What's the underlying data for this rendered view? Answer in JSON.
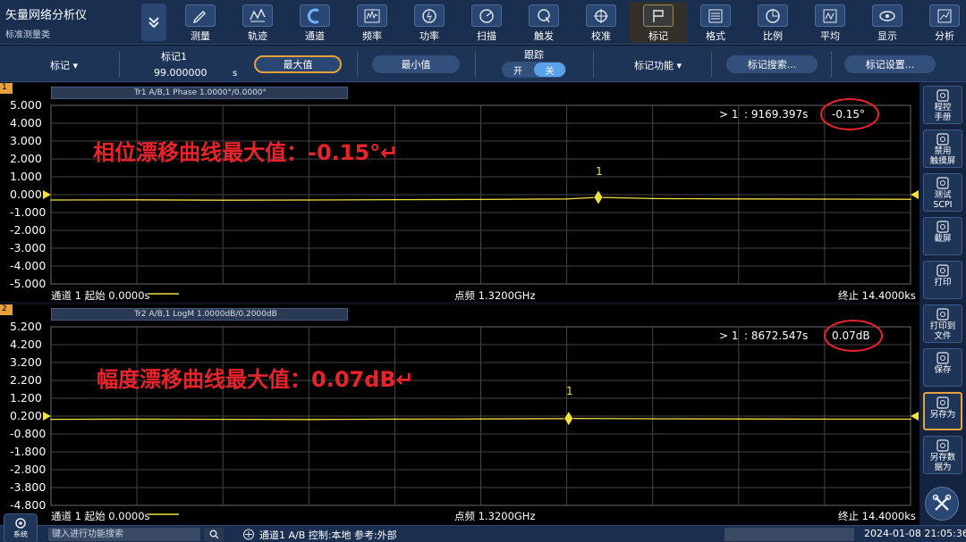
{
  "app": {
    "title": "矢量网络分析仪",
    "subtitle": "标准测量类"
  },
  "tabs": [
    {
      "label": "测量",
      "icon": "pencil-icon"
    },
    {
      "label": "轨迹",
      "icon": "trace-icon"
    },
    {
      "label": "通道",
      "icon": "channel-icon"
    },
    {
      "label": "频率",
      "icon": "frequency-icon"
    },
    {
      "label": "功率",
      "icon": "power-icon"
    },
    {
      "label": "扫描",
      "icon": "sweep-icon"
    },
    {
      "label": "触发",
      "icon": "trigger-icon"
    },
    {
      "label": "校准",
      "icon": "calibration-icon"
    },
    {
      "label": "标记",
      "icon": "marker-flag-icon",
      "active": true
    },
    {
      "label": "格式",
      "icon": "format-icon"
    },
    {
      "label": "比例",
      "icon": "scale-icon"
    },
    {
      "label": "平均",
      "icon": "average-icon"
    },
    {
      "label": "显示",
      "icon": "display-eye-icon"
    },
    {
      "label": "分析",
      "icon": "analysis-icon"
    }
  ],
  "marker_bar": {
    "marker_dropdown": "标记 ▾",
    "marker_name": "标记1",
    "marker_value": "99.000000",
    "marker_unit": "s",
    "max_btn": "最大值",
    "min_btn": "最小值",
    "tracking_label": "跟踪",
    "toggle_on": "开",
    "toggle_off": "关",
    "function_dropdown": "标记功能 ▾",
    "search_btn": "标记搜索...",
    "settings_btn": "标记设置..."
  },
  "chart1": {
    "channel_num": "1",
    "trace_label": "Tr1 A/B,1 Phase 1.0000°/0.0000°",
    "y_ticks": [
      "5.000",
      "4.000",
      "3.000",
      "2.000",
      "1.000",
      "0.000",
      "-1.000",
      "-2.000",
      "-3.000",
      "-4.000",
      "-5.000"
    ],
    "annotation": "相位漂移曲线最大值：-0.15°↵",
    "readout_marker": "> 1",
    "readout_time": ": 9169.397s",
    "readout_value": "-0.15°",
    "marker_label": "1",
    "bottom_left": "通道 1 起始 0.0000s",
    "bottom_mid": "点频 1.3200GHz",
    "bottom_right": "终止 14.4000ks"
  },
  "chart2": {
    "channel_num": "2",
    "trace_label": "Tr2 A/B,1 LogM 1.0000dB/0.2000dB",
    "y_ticks": [
      "5.200",
      "4.200",
      "3.200",
      "2.200",
      "1.200",
      "0.200",
      "-0.800",
      "-1.800",
      "-2.800",
      "-3.800",
      "-4.800"
    ],
    "annotation": "幅度漂移曲线最大值：0.07dB↵",
    "readout_marker": "> 1",
    "readout_time": ": 8672.547s",
    "readout_value": "0.07dB",
    "marker_label": "1",
    "bottom_left": "通道 1 起始 0.0000s",
    "bottom_mid": "点频 1.3200GHz",
    "bottom_right": "终止 14.4000ks"
  },
  "chart_data": [
    {
      "type": "line",
      "title": "Tr1 A/B,1 Phase 1.0000°/0.0000°",
      "xlabel": "",
      "ylabel": "",
      "x_range": [
        0,
        14400
      ],
      "ylim": [
        -5.0,
        5.0
      ],
      "series": [
        {
          "x": [
            0,
            1440,
            2880,
            4320,
            5760,
            7200,
            8640,
            9169.397,
            10080,
            11520,
            12960,
            14400
          ],
          "y": [
            -0.3,
            -0.29,
            -0.31,
            -0.3,
            -0.28,
            -0.27,
            -0.24,
            -0.15,
            -0.22,
            -0.24,
            -0.25,
            -0.26
          ]
        }
      ],
      "marker": {
        "x": 9169.397,
        "y": -0.15
      }
    },
    {
      "type": "line",
      "title": "Tr2 A/B,1 LogM 1.0000dB/0.2000dB",
      "xlabel": "",
      "ylabel": "",
      "x_range": [
        0,
        14400
      ],
      "ylim": [
        -4.8,
        5.2
      ],
      "series": [
        {
          "x": [
            0,
            1440,
            2880,
            4320,
            5760,
            7200,
            8640,
            8672.547,
            10080,
            11520,
            12960,
            14400
          ],
          "y": [
            0.02,
            0.03,
            0.02,
            0.01,
            0.03,
            0.04,
            0.06,
            0.07,
            0.05,
            0.04,
            0.03,
            0.03
          ]
        }
      ],
      "marker": {
        "x": 8672.547,
        "y": 0.07
      }
    }
  ],
  "right_panel": [
    {
      "label": "程控\n手册",
      "icon": "manual-icon"
    },
    {
      "label": "禁用\n触摸屏",
      "icon": "touch-disable-icon"
    },
    {
      "label": "测试\nSCPI",
      "icon": "scpi-icon"
    },
    {
      "label": "截屏",
      "icon": "screenshot-icon"
    },
    {
      "label": "打印",
      "icon": "printer-icon"
    },
    {
      "label": "打印到\n文件",
      "icon": "print-to-file-icon"
    },
    {
      "label": "保存",
      "icon": "save-icon"
    },
    {
      "label": "另存为",
      "icon": "save-as-icon",
      "highlight": true
    },
    {
      "label": "另存数\n据为",
      "icon": "save-data-icon"
    }
  ],
  "status": {
    "system_btn": "系统",
    "search_placeholder": "键入进行功能搜索",
    "info": "通道1 A/B 控制:本地 参考:外部",
    "datetime": "2024-01-08 21:05:36"
  },
  "colors": {
    "trace": "#f0e040",
    "annotation_red": "#e8232c",
    "accent_orange": "#e8a13a",
    "toggle_blue": "#5aa3ea"
  }
}
